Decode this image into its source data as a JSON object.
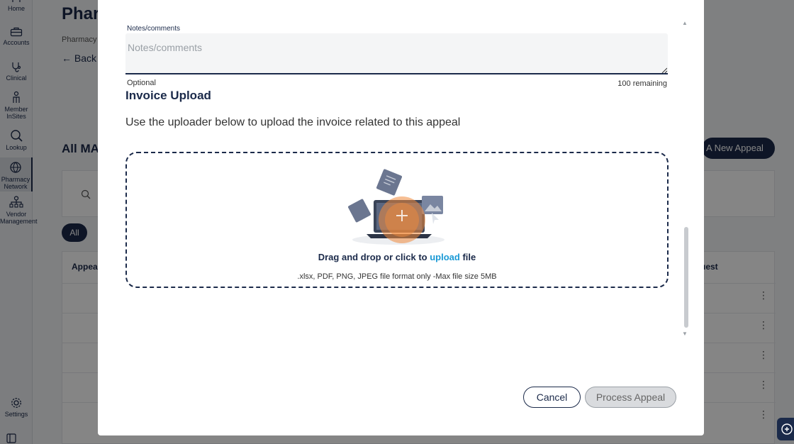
{
  "sidebar": {
    "items": [
      {
        "label": "Home",
        "icon": "home-icon"
      },
      {
        "label": "Accounts",
        "icon": "briefcase-icon"
      },
      {
        "label": "Clinical",
        "icon": "stethoscope-icon"
      },
      {
        "label": "Member InSites",
        "icon": "people-icon"
      },
      {
        "label": "Lookup",
        "icon": "search-icon"
      },
      {
        "label": "Pharmacy Network",
        "icon": "globe-icon",
        "active": true
      },
      {
        "label": "Vendor Management",
        "icon": "org-chart-icon"
      },
      {
        "label": "Settings",
        "icon": "gear-icon"
      }
    ]
  },
  "background": {
    "title": "Phar",
    "breadcrumb": "Pharmacy N",
    "back_label": "Back",
    "section_title": "All MA",
    "new_appeal_label": "A New Appeal",
    "filter_all": "All",
    "table_header_left": "Appeal",
    "table_header_right": "uest"
  },
  "modal": {
    "notes_label": "Notes/comments",
    "notes_value": "",
    "notes_placeholder": "Notes/comments",
    "optional_text": "Optional",
    "remaining_text": "100 remaining",
    "upload_title": "Invoice Upload",
    "upload_description": "Use the uploader below to upload the invoice related to this appeal",
    "dropzone_text_before": "Drag and drop or click to",
    "dropzone_link": "upload",
    "dropzone_text_after": "file",
    "dropzone_hint": ".xlsx, PDF, PNG, JPEG file format only -Max file size 5MB",
    "cancel_label": "Cancel",
    "process_label": "Process Appeal"
  },
  "colors": {
    "brand_navy": "#1b2a4a",
    "link_blue": "#1a9ad6",
    "cursor_orange": "#f08a3c"
  }
}
